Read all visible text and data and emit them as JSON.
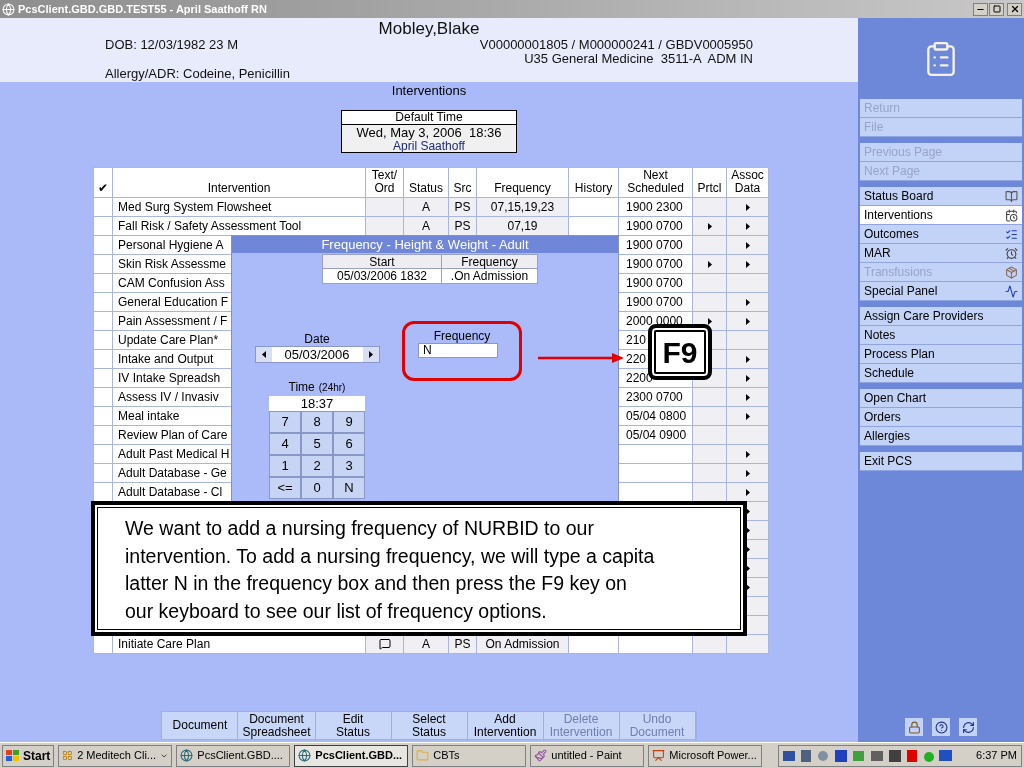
{
  "window": {
    "title": "PcsClient.GBD.GBD.TEST55 - April Saathoff RN"
  },
  "patient": {
    "name": "Mobley,Blake",
    "dob": "DOB: 12/03/1982 23 M",
    "account": "V00000001805 / M000000241 / GBDV0005950",
    "location": "U35 General Medicine  3511-A  ADM IN",
    "allergy": "Allergy/ADR: Codeine, Penicillin"
  },
  "page_title": "Interventions",
  "default_time": {
    "label": "Default Time",
    "datetime": "Wed, May 3, 2006  18:36",
    "user": "April Saathoff"
  },
  "table": {
    "columns": [
      "✔",
      "Intervention",
      "Text/\nOrd",
      "Status",
      "Src",
      "Frequency",
      "History",
      "Next\nScheduled",
      "Prtcl",
      "Assoc\nData"
    ],
    "rows": [
      {
        "intervention": "Med Surg System Flowsheet",
        "note": false,
        "status": "A",
        "src": "PS",
        "frequency": "07,15,19,23",
        "next": "1900 2300",
        "protocol": false,
        "assoc": true
      },
      {
        "intervention": "Fall Risk / Safety Assessment Tool",
        "note": false,
        "status": "A",
        "src": "PS",
        "frequency": "07,19",
        "next": "1900 0700",
        "protocol": true,
        "assoc": true
      },
      {
        "intervention": "Personal Hygiene A",
        "next": "1900 0700",
        "protocol": false,
        "assoc": true
      },
      {
        "intervention": "Skin Risk Assessme",
        "next": "1900 0700",
        "protocol": true,
        "assoc": true
      },
      {
        "intervention": "CAM Confusion Ass",
        "next": "1900 0700",
        "protocol": false,
        "assoc": false
      },
      {
        "intervention": "General Education F",
        "next": "1900 0700",
        "protocol": false,
        "assoc": true
      },
      {
        "intervention": "Pain Assessment / F",
        "next": "2000 0000",
        "protocol": true,
        "assoc": true
      },
      {
        "intervention": "Update Care Plan*",
        "next": "210",
        "protocol": false,
        "assoc": false
      },
      {
        "intervention": "Intake and Output",
        "next": "220",
        "protocol": false,
        "assoc": true
      },
      {
        "intervention": "IV Intake Spreadsh",
        "next": "2200",
        "protocol": false,
        "assoc": true
      },
      {
        "intervention": "Assess IV / Invasiv",
        "next": "2300 0700",
        "protocol": false,
        "assoc": true
      },
      {
        "intervention": "Meal intake",
        "next": "05/04 0800",
        "protocol": false,
        "assoc": true
      },
      {
        "intervention": "Review Plan of Care",
        "next": "05/04 0900",
        "protocol": false,
        "assoc": false
      },
      {
        "intervention": "Adult Past Medical H",
        "protocol": false,
        "assoc": true
      },
      {
        "intervention": "Adult Database - Ge",
        "protocol": false,
        "assoc": true
      },
      {
        "intervention": "Adult Database - Cl",
        "protocol": false,
        "assoc": true
      },
      {
        "assoc": true
      },
      {
        "assoc": true
      },
      {
        "assoc": true
      },
      {
        "assoc": true
      },
      {
        "assoc": true
      },
      {
        "assoc": false
      },
      {
        "assoc": false
      },
      {
        "intervention": "Initiate Care Plan",
        "note": true,
        "status": "A",
        "src": "PS",
        "frequency": "On Admission",
        "protocol": false,
        "assoc": false
      }
    ]
  },
  "dialog": {
    "title": "Frequency - Height & Weight - Adult",
    "columns": [
      "Start",
      "Frequency"
    ],
    "row": [
      "05/03/2006 1832",
      ".On Admission"
    ],
    "date_label": "Date",
    "date": "05/03/2006",
    "time_label": "Time",
    "time_hint": "(24hr)",
    "time": "18:37",
    "keys": [
      "7",
      "8",
      "9",
      "4",
      "5",
      "6",
      "1",
      "2",
      "3",
      "<=",
      "0",
      "N"
    ],
    "frequency_label": "Frequency",
    "frequency_value": "N"
  },
  "key_label": "F9",
  "callout": [
    "We want to add a nursing frequency of NURBID to our",
    "intervention. To add a nursing frequency, we will type a capita",
    "latter N in the frequency box and then press the F9 key on",
    "our keyboard to see our list of frequency options."
  ],
  "actions": [
    {
      "label": "Document",
      "disabled": false
    },
    {
      "label": "Document\nSpreadsheet",
      "disabled": false
    },
    {
      "label": "Edit\nStatus",
      "disabled": false
    },
    {
      "label": "Select\nStatus",
      "disabled": false
    },
    {
      "label": "Add\nIntervention",
      "disabled": false
    },
    {
      "label": "Delete\nIntervention",
      "disabled": true
    },
    {
      "label": "Undo\nDocument",
      "disabled": true
    }
  ],
  "sidebar": {
    "groups": [
      [
        {
          "label": "Return",
          "disabled": true,
          "selected": false
        },
        {
          "label": "File",
          "disabled": true,
          "selected": false
        }
      ],
      [
        {
          "label": "Previous Page",
          "disabled": true,
          "selected": false
        },
        {
          "label": "Next Page",
          "disabled": true,
          "selected": false
        }
      ],
      [
        {
          "label": "Status Board",
          "disabled": false,
          "selected": false
        },
        {
          "label": "Interventions",
          "disabled": false,
          "selected": true
        },
        {
          "label": "Outcomes",
          "disabled": false,
          "selected": false
        },
        {
          "label": "MAR",
          "disabled": false,
          "selected": false
        },
        {
          "label": "Transfusions",
          "disabled": true,
          "selected": false
        },
        {
          "label": "Special Panel",
          "disabled": false,
          "selected": false
        }
      ],
      [
        {
          "label": "Assign Care Providers",
          "disabled": false,
          "selected": false
        },
        {
          "label": "Notes",
          "disabled": false,
          "selected": false
        },
        {
          "label": "Process Plan",
          "disabled": false,
          "selected": false
        },
        {
          "label": "Schedule",
          "disabled": false,
          "selected": false
        }
      ],
      [
        {
          "label": "Open Chart",
          "disabled": false,
          "selected": false
        },
        {
          "label": "Orders",
          "disabled": false,
          "selected": false
        },
        {
          "label": "Allergies",
          "disabled": false,
          "selected": false
        }
      ],
      [
        {
          "label": "Exit PCS",
          "disabled": false,
          "selected": false
        }
      ]
    ]
  },
  "taskbar": {
    "start": "Start",
    "tasks": [
      {
        "label": "2 Meditech Cli...",
        "selected": false
      },
      {
        "label": "PcsClient.GBD....",
        "selected": false
      },
      {
        "label": "PcsClient.GBD...",
        "selected": true
      },
      {
        "label": "CBTs",
        "selected": false
      },
      {
        "label": "untitled - Paint",
        "selected": false
      },
      {
        "label": "Microsoft Power...",
        "selected": false
      }
    ],
    "clock": "6:37 PM"
  }
}
